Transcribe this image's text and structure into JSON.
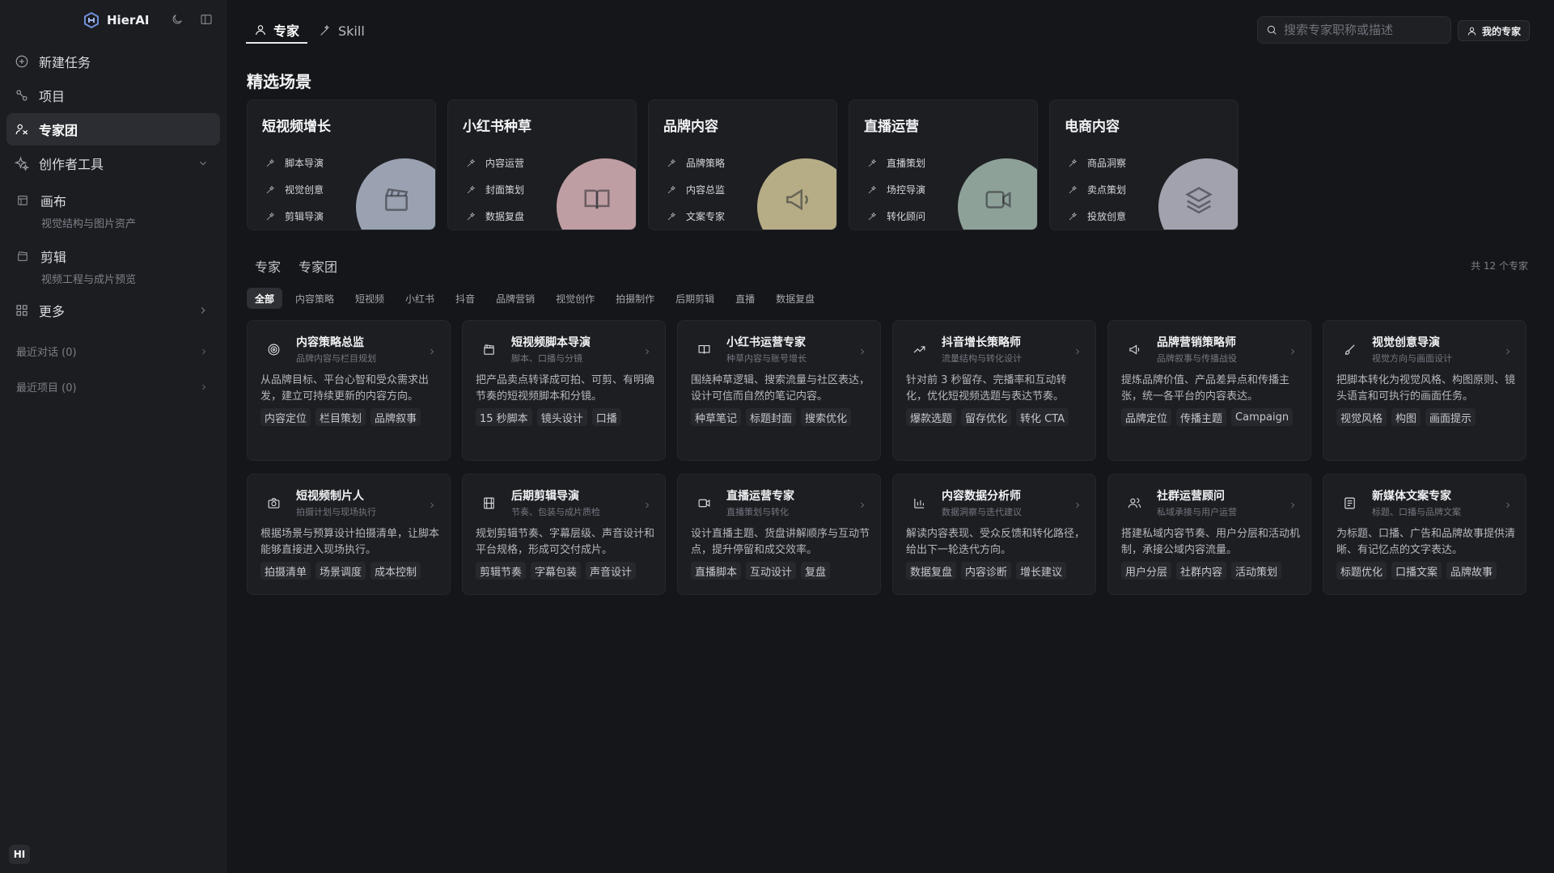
{
  "sidebar": {
    "brand": "HierAI",
    "nav": [
      {
        "label": "新建任务",
        "icon": "plus-circle-icon"
      },
      {
        "label": "项目",
        "icon": "project-icon"
      },
      {
        "label": "专家团",
        "icon": "team-icon"
      },
      {
        "label": "创作者工具",
        "icon": "sparkle-icon"
      }
    ],
    "tools": [
      {
        "label": "画布",
        "desc": "视觉结构与图片资产",
        "icon": "canvas-icon"
      },
      {
        "label": "剪辑",
        "desc": "视频工程与成片预览",
        "icon": "clapper-icon"
      }
    ],
    "more": "更多",
    "recent_chats": "最近对话 (0)",
    "recent_projects": "最近项目 (0)",
    "user_initials": "HI"
  },
  "header": {
    "tabs": [
      "专家",
      "Skill"
    ],
    "search_placeholder": "搜索专家职称或描述",
    "my_experts": "我的专家"
  },
  "featured": {
    "title": "精选场景",
    "scenes": [
      {
        "title": "短视频增长",
        "items": [
          "脚本导演",
          "视觉创意",
          "剪辑导演"
        ],
        "color": "#9aa2b1",
        "icon": "clapper-icon"
      },
      {
        "title": "小红书种草",
        "items": [
          "内容运营",
          "封面策划",
          "数据复盘"
        ],
        "color": "#bf9ea3",
        "icon": "book-icon"
      },
      {
        "title": "品牌内容",
        "items": [
          "品牌策略",
          "内容总监",
          "文案专家"
        ],
        "color": "#b6ad86",
        "icon": "megaphone-icon"
      },
      {
        "title": "直播运营",
        "items": [
          "直播策划",
          "场控导演",
          "转化顾问"
        ],
        "color": "#8ea198",
        "icon": "video-icon"
      },
      {
        "title": "电商内容",
        "items": [
          "商品洞察",
          "卖点策划",
          "投放创意"
        ],
        "color": "#a2a1ae",
        "icon": "layers-icon"
      }
    ]
  },
  "experts_section": {
    "tabs": [
      "专家",
      "专家团"
    ],
    "total": "共 12 个专家",
    "filters": [
      "全部",
      "内容策略",
      "短视频",
      "小红书",
      "抖音",
      "品牌营销",
      "视觉创作",
      "拍摄制作",
      "后期剪辑",
      "直播",
      "数据复盘"
    ],
    "cards": [
      {
        "title": "内容策略总监",
        "subtitle": "品牌内容与栏目规划",
        "desc": "从品牌目标、平台心智和受众需求出发，建立可持续更新的内容方向。",
        "tags": [
          "内容定位",
          "栏目策划",
          "品牌叙事"
        ],
        "icon": "target-icon"
      },
      {
        "title": "短视频脚本导演",
        "subtitle": "脚本、口播与分镜",
        "desc": "把产品卖点转译成可拍、可剪、有明确节奏的短视频脚本和分镜。",
        "tags": [
          "15 秒脚本",
          "镜头设计",
          "口播"
        ],
        "icon": "clapper-icon"
      },
      {
        "title": "小红书运营专家",
        "subtitle": "种草内容与账号增长",
        "desc": "围绕种草逻辑、搜索流量与社区表达，设计可信而自然的笔记内容。",
        "tags": [
          "种草笔记",
          "标题封面",
          "搜索优化"
        ],
        "icon": "book-icon"
      },
      {
        "title": "抖音增长策略师",
        "subtitle": "流量结构与转化设计",
        "desc": "针对前 3 秒留存、完播率和互动转化，优化短视频选题与表达节奏。",
        "tags": [
          "爆款选题",
          "留存优化",
          "转化 CTA"
        ],
        "icon": "trend-up-icon"
      },
      {
        "title": "品牌营销策略师",
        "subtitle": "品牌叙事与传播战役",
        "desc": "提炼品牌价值、产品差异点和传播主张，统一各平台的内容表达。",
        "tags": [
          "品牌定位",
          "传播主题",
          "Campaign"
        ],
        "icon": "megaphone-icon"
      },
      {
        "title": "视觉创意导演",
        "subtitle": "视觉方向与画面设计",
        "desc": "把脚本转化为视觉风格、构图原则、镜头语言和可执行的画面任务。",
        "tags": [
          "视觉风格",
          "构图",
          "画面提示"
        ],
        "icon": "brush-icon"
      },
      {
        "title": "短视频制片人",
        "subtitle": "拍摄计划与现场执行",
        "desc": "根据场景与预算设计拍摄清单，让脚本能够直接进入现场执行。",
        "tags": [
          "拍摄清单",
          "场景调度",
          "成本控制"
        ],
        "icon": "camera-icon"
      },
      {
        "title": "后期剪辑导演",
        "subtitle": "节奏、包装与成片质检",
        "desc": "规划剪辑节奏、字幕层级、声音设计和平台规格，形成可交付成片。",
        "tags": [
          "剪辑节奏",
          "字幕包装",
          "声音设计"
        ],
        "icon": "film-icon"
      },
      {
        "title": "直播运营专家",
        "subtitle": "直播策划与转化",
        "desc": "设计直播主题、货盘讲解顺序与互动节点，提升停留和成交效率。",
        "tags": [
          "直播脚本",
          "互动设计",
          "复盘"
        ],
        "icon": "video-icon"
      },
      {
        "title": "内容数据分析师",
        "subtitle": "数据洞察与迭代建议",
        "desc": "解读内容表现、受众反馈和转化路径，给出下一轮迭代方向。",
        "tags": [
          "数据复盘",
          "内容诊断",
          "增长建议"
        ],
        "icon": "bar-chart-icon"
      },
      {
        "title": "社群运营顾问",
        "subtitle": "私域承接与用户运营",
        "desc": "搭建私域内容节奏、用户分层和活动机制，承接公域内容流量。",
        "tags": [
          "用户分层",
          "社群内容",
          "活动策划"
        ],
        "icon": "users-icon"
      },
      {
        "title": "新媒体文案专家",
        "subtitle": "标题、口播与品牌文案",
        "desc": "为标题、口播、广告和品牌故事提供清晰、有记忆点的文字表达。",
        "tags": [
          "标题优化",
          "口播文案",
          "品牌故事"
        ],
        "icon": "document-icon"
      }
    ]
  }
}
